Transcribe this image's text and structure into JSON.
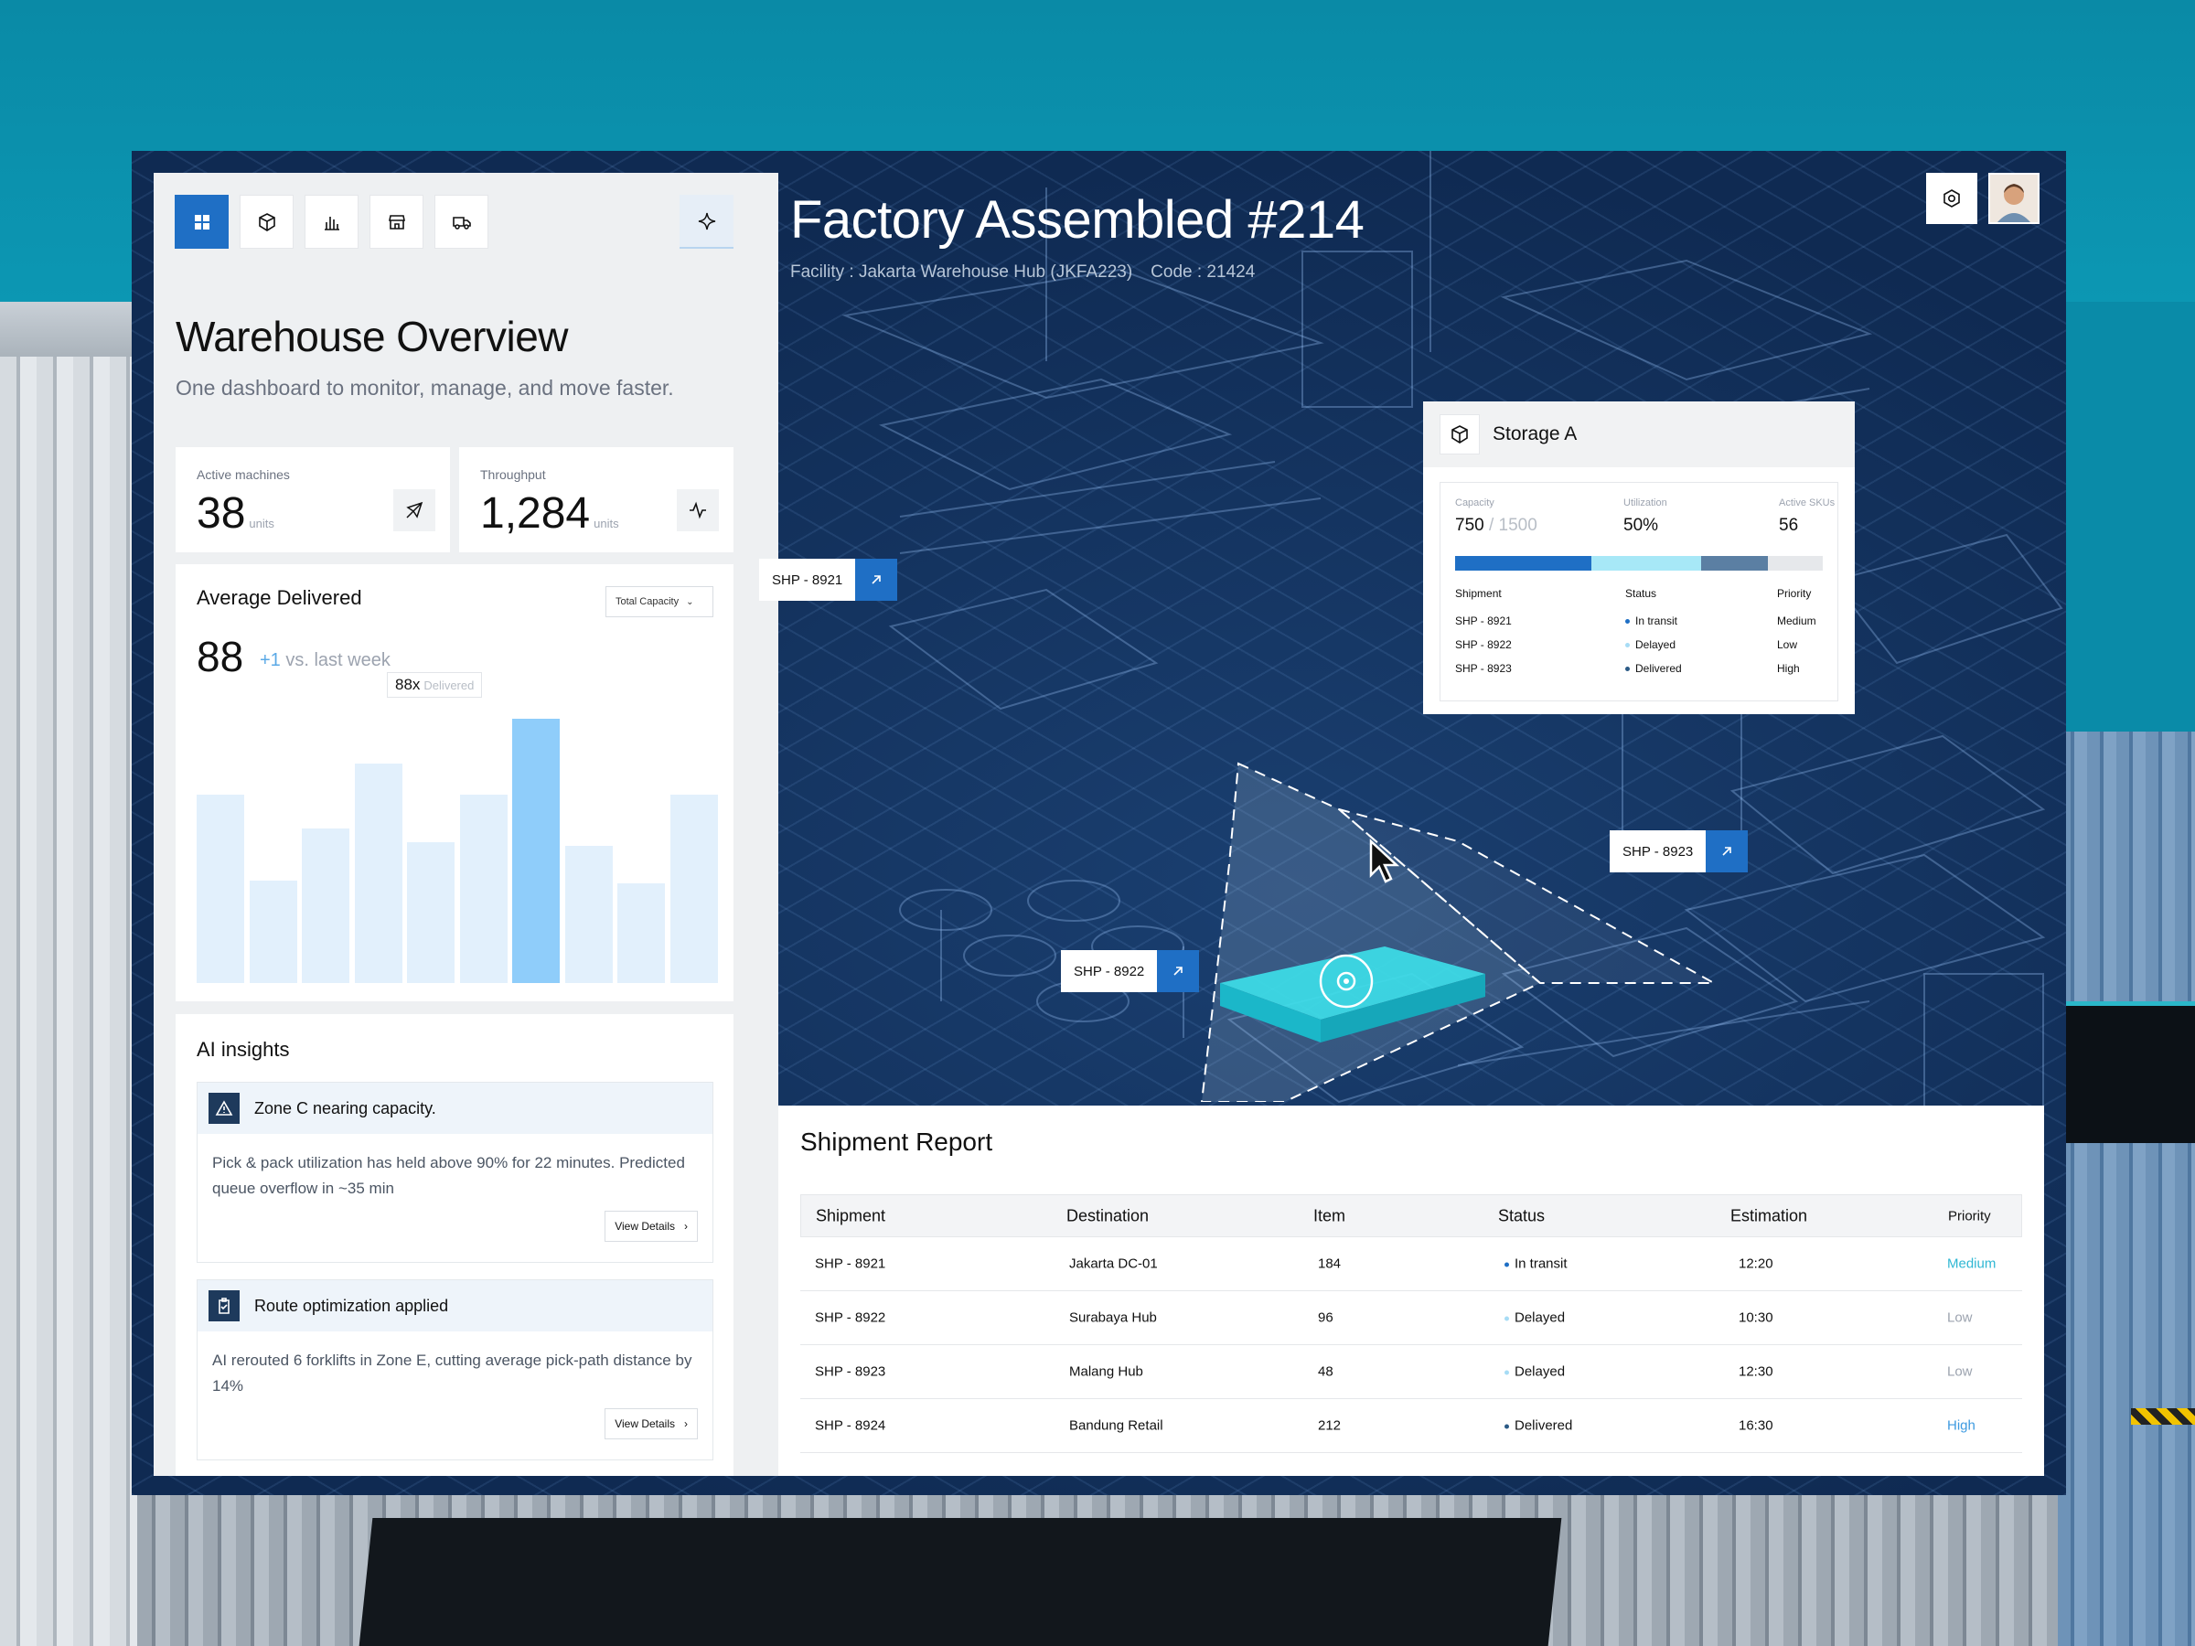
{
  "toolbar": {
    "icons": [
      "dashboard-icon",
      "box-icon",
      "bar-chart-icon",
      "store-icon",
      "truck-icon"
    ],
    "ai_icon": "sparkle-icon"
  },
  "overview": {
    "title": "Warehouse Overview",
    "subtitle": "One dashboard to monitor, manage, and move faster."
  },
  "stats": [
    {
      "label": "Active machines",
      "value": "38",
      "unit": "units",
      "icon": "plane-icon"
    },
    {
      "label": "Throughput",
      "value": "1,284",
      "unit": "units",
      "icon": "activity-icon"
    }
  ],
  "avg": {
    "title": "Average Delivered",
    "dropdown": "Total Capacity",
    "value": "88",
    "delta": "+1",
    "delta_text": "vs. last week",
    "tooltip_value": "88x",
    "tooltip_label": "Delivered"
  },
  "chart_data": {
    "type": "bar",
    "values": [
      55,
      30,
      45,
      64,
      41,
      55,
      77,
      40,
      29,
      55
    ],
    "highlight_index": 6,
    "ylim": [
      0,
      100
    ]
  },
  "insights": {
    "title": "AI insights",
    "items": [
      {
        "title": "Zone C nearing capacity.",
        "body": "Pick & pack utilization has held above 90% for 22 minutes. Predicted queue overflow in ~35 min",
        "button": "View Details",
        "icon": "warning-icon"
      },
      {
        "title": "Route optimization applied",
        "body": "AI rerouted 6 forklifts in Zone E, cutting average pick-path distance by 14%",
        "button": "View Details",
        "icon": "clipboard-check-icon"
      }
    ]
  },
  "header": {
    "title": "Factory Assembled #214",
    "facility": "Facility : Jakarta Warehouse Hub (JKFA223)",
    "code": "Code : 21424"
  },
  "map_tags": {
    "t1": "SHP - 8921",
    "t2": "SHP - 8922",
    "t3": "SHP - 8923"
  },
  "storage": {
    "title": "Storage A",
    "capacity_label": "Capacity",
    "capacity_value": "750",
    "capacity_max": "/ 1500",
    "util_label": "Utilization",
    "util_value": "50%",
    "skus_label": "Active SKUs",
    "skus_value": "56",
    "bar_segments": [
      0.37,
      0.3,
      0.18,
      0.15
    ],
    "col_shipment": "Shipment",
    "col_status": "Status",
    "col_priority": "Priority",
    "rows": [
      {
        "id": "SHP - 8921",
        "status": "In transit",
        "priority": "Medium"
      },
      {
        "id": "SHP - 8922",
        "status": "Delayed",
        "priority": "Low"
      },
      {
        "id": "SHP - 8923",
        "status": "Delivered",
        "priority": "High"
      }
    ]
  },
  "report": {
    "title": "Shipment Report",
    "columns": [
      "Shipment",
      "Destination",
      "Item",
      "Status",
      "Estimation",
      "Priority"
    ],
    "rows": [
      {
        "id": "SHP - 8921",
        "dest": "Jakarta DC-01",
        "item": "184",
        "status": "In transit",
        "eta": "12:20",
        "priority": "Medium"
      },
      {
        "id": "SHP - 8922",
        "dest": "Surabaya Hub",
        "item": "96",
        "status": "Delayed",
        "eta": "10:30",
        "priority": "Low"
      },
      {
        "id": "SHP - 8923",
        "dest": "Malang Hub",
        "item": "48",
        "status": "Delayed",
        "eta": "12:30",
        "priority": "Low"
      },
      {
        "id": "SHP - 8924",
        "dest": "Bandung Retail",
        "item": "212",
        "status": "Delivered",
        "eta": "16:30",
        "priority": "High"
      }
    ]
  },
  "colors": {
    "accent": "#1f6fc5",
    "teal": "#1bc3d6",
    "in_transit": "#1f6fc5",
    "delayed": "#a7dcf5",
    "delivered": "#2b5a86",
    "priority_medium": "#2fb7d3",
    "priority_low": "#9ca3af",
    "priority_high": "#3d9ae0"
  }
}
